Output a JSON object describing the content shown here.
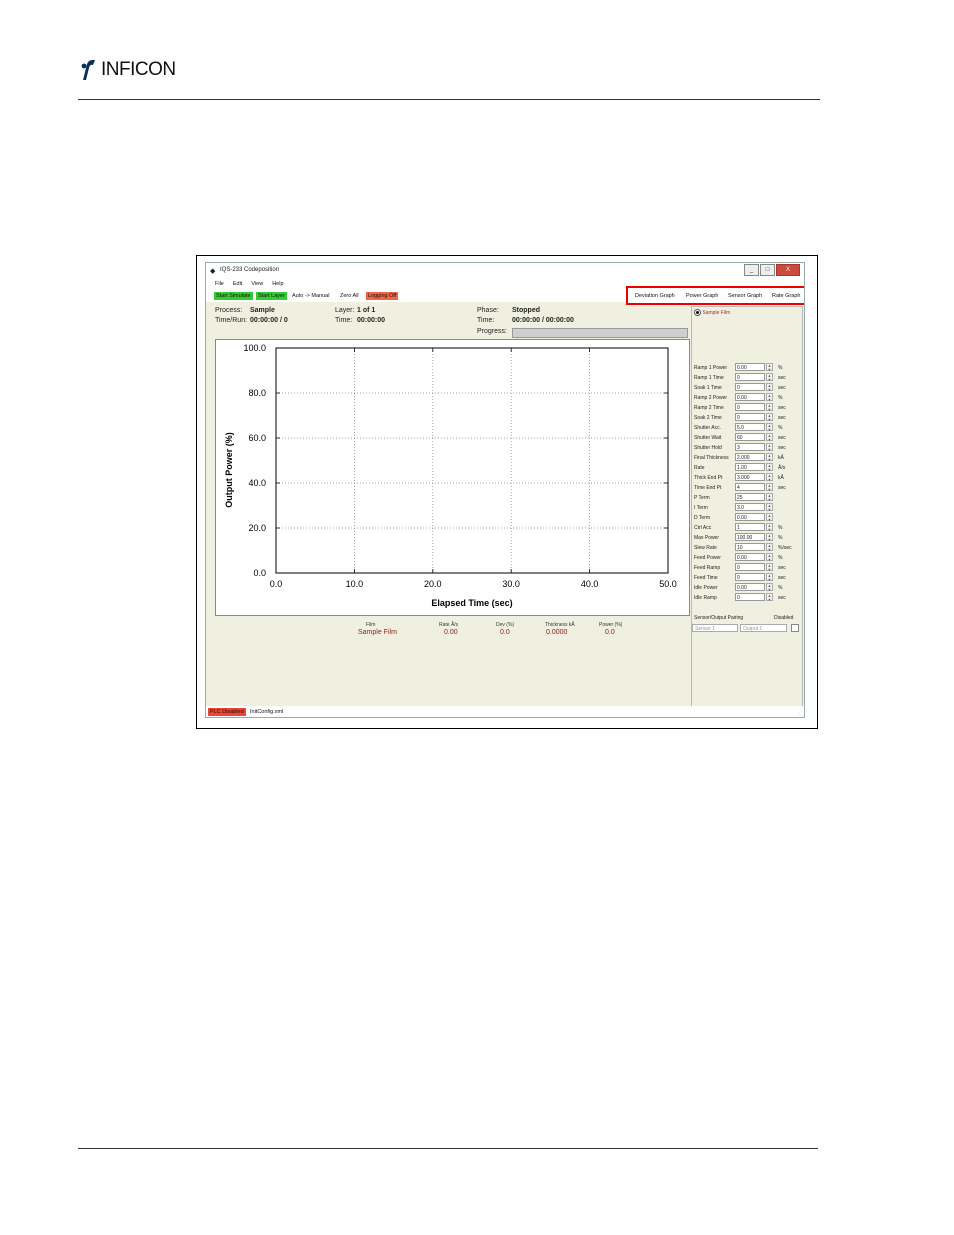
{
  "doc": {
    "logo_text": "INFICON"
  },
  "window": {
    "title": "IQS-233 Codeposition",
    "controls": [
      "_",
      "□",
      "X"
    ]
  },
  "menu": [
    "File",
    "Edit",
    "View",
    "Help"
  ],
  "toolbar": {
    "start_simulate": "Start Simulate",
    "start_layer": "Start Layer",
    "auto_manual": "Auto -> Manual",
    "zero_all": "Zero All",
    "logging_off": "Logging Off"
  },
  "graph_buttons": [
    "Deviation Graph",
    "Power Graph",
    "Sensor Graph",
    "Rate Graph"
  ],
  "status": {
    "process_label": "Process:",
    "process_value": "Sample",
    "timerun_label": "Time/Run:",
    "timerun_value": "00:00:00 / 0",
    "layer_label": "Layer:",
    "layer_value": "1 of 1",
    "time_label": "Time:",
    "time_value": "00:00:00",
    "phase_label": "Phase:",
    "phase_value": "Stopped",
    "time2_label": "Time:",
    "time2_value": "00:00:00 / 00:00:00",
    "progress_label": "Progress:",
    "progress_fraction": 0
  },
  "chart_data": {
    "type": "line",
    "xlabel": "Elapsed Time (sec)",
    "ylabel": "Output Power (%)",
    "xlim": [
      0,
      50
    ],
    "ylim": [
      0,
      100
    ],
    "x_ticks": [
      "0.0",
      "10.0",
      "20.0",
      "30.0",
      "40.0",
      "50.0"
    ],
    "y_ticks": [
      "0.0",
      "20.0",
      "40.0",
      "60.0",
      "80.0",
      "100.0"
    ],
    "grid": true,
    "series": []
  },
  "film": {
    "radio_label": "Sample Film"
  },
  "params": [
    {
      "label": "Ramp 1 Power",
      "value": "0.00",
      "unit": "%"
    },
    {
      "label": "Ramp 1 Time",
      "value": "0",
      "unit": "sec"
    },
    {
      "label": "Soak 1 Time",
      "value": "0",
      "unit": "sec"
    },
    {
      "label": "Ramp 2 Power",
      "value": "0.00",
      "unit": "%"
    },
    {
      "label": "Ramp 2 Time",
      "value": "0",
      "unit": "sec"
    },
    {
      "label": "Soak 2 Time",
      "value": "0",
      "unit": "sec"
    },
    {
      "label": "Shutter Acc.",
      "value": "5.0",
      "unit": "%"
    },
    {
      "label": "Shutter Wait",
      "value": "60",
      "unit": "sec"
    },
    {
      "label": "Shutter Hold",
      "value": "3",
      "unit": "sec"
    },
    {
      "label": "Final Thickness",
      "value": "2.000",
      "unit": "kÅ"
    },
    {
      "label": "Rate",
      "value": "1.00",
      "unit": "Å/s"
    },
    {
      "label": "Thick End Pt",
      "value": "3.000",
      "unit": "kÅ"
    },
    {
      "label": "Time End Pt",
      "value": "4",
      "unit": "sec"
    },
    {
      "label": "P Term",
      "value": "25",
      "unit": ""
    },
    {
      "label": "I Term",
      "value": "3.0",
      "unit": ""
    },
    {
      "label": "D Term",
      "value": "0.00",
      "unit": ""
    },
    {
      "label": "Ctrl Acc",
      "value": "1",
      "unit": "%"
    },
    {
      "label": "Max Power",
      "value": "100.00",
      "unit": "%"
    },
    {
      "label": "Slew Rate",
      "value": "10",
      "unit": "%/sec"
    },
    {
      "label": "Feed Power",
      "value": "0.00",
      "unit": "%"
    },
    {
      "label": "Feed Ramp",
      "value": "0",
      "unit": "sec"
    },
    {
      "label": "Feed Time",
      "value": "0",
      "unit": "sec"
    },
    {
      "label": "Idle Power",
      "value": "0.00",
      "unit": "%"
    },
    {
      "label": "Idle Ramp",
      "value": "0",
      "unit": "sec"
    }
  ],
  "pairing": {
    "header": "Sensor/Output Pairing",
    "disabled_label": "Disabled",
    "sensor": "Sensor 1",
    "output": "Output 1"
  },
  "readout": {
    "headers": [
      "Film",
      "Rate Å/s",
      "Dev (%)",
      "Thickness kÅ",
      "Power (%)"
    ],
    "values": [
      "Sample Film",
      "0.00",
      "0.0",
      "0.0000",
      "0.0"
    ]
  },
  "statusbar": {
    "plc": "PLC Disabled",
    "config": "InitConfig.xml"
  },
  "colors": {
    "green_button": "#33cc33",
    "red_button": "#ee6644",
    "panel_bg": "#f0f0e0",
    "highlight": "#ee0000"
  }
}
